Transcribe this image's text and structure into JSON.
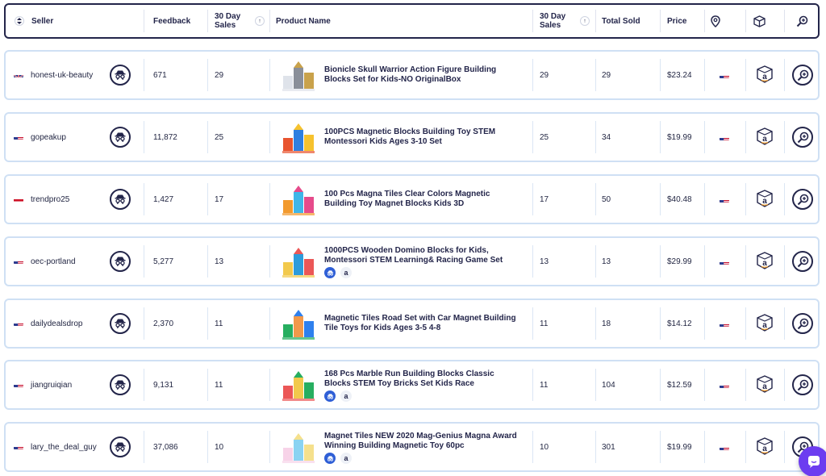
{
  "columns": {
    "seller": "Seller",
    "feedback": "Feedback",
    "sales30": "30 Day Sales",
    "product_name": "Product Name",
    "sales30_b": "30 Day Sales",
    "total_sold": "Total Sold",
    "price": "Price",
    "location_icon": "map-pin-icon",
    "box_icon": "package-icon",
    "zoom_icon": "magnifier-plus-icon"
  },
  "colors": {
    "navy": "#23254a",
    "row_border": "#cfe0f4",
    "prime_blue": "#2f5fd6",
    "chat": "#6c3cf0"
  },
  "rows": [
    {
      "flag": "uk",
      "seller": "honest-uk-beauty",
      "feedback": "671",
      "sales30": "29",
      "product": "Bionicle Skull Warrior Action Figure Building Blocks Set for Kids-NO OriginalBox",
      "sales30_b": "29",
      "total_sold": "29",
      "price": "$23.24",
      "tags": false
    },
    {
      "flag": "us",
      "seller": "gopeakup",
      "feedback": "11,872",
      "sales30": "25",
      "product": "100PCS Magnetic Blocks Building Toy STEM Montessori Kids Ages 3-10 Set",
      "sales30_b": "25",
      "total_sold": "34",
      "price": "$19.99",
      "tags": false
    },
    {
      "flag": "eg",
      "seller": "trendpro25",
      "feedback": "1,427",
      "sales30": "17",
      "product": "100 Pcs Magna Tiles Clear Colors Magnetic Building Toy Magnet Blocks Kids 3D",
      "sales30_b": "17",
      "total_sold": "50",
      "price": "$40.48",
      "tags": false
    },
    {
      "flag": "us",
      "seller": "oec-portland",
      "feedback": "5,277",
      "sales30": "13",
      "product": "1000PCS Wooden Domino Blocks for Kids, Montessori STEM Learning& Racing Game Set",
      "sales30_b": "13",
      "total_sold": "13",
      "price": "$29.99",
      "tags": true
    },
    {
      "flag": "us",
      "seller": "dailydealsdrop",
      "feedback": "2,370",
      "sales30": "11",
      "product": "Magnetic Tiles Road Set with Car Magnet Building Tile Toys for Kids Ages 3-5 4-8",
      "sales30_b": "11",
      "total_sold": "18",
      "price": "$14.12",
      "tags": false
    },
    {
      "flag": "us",
      "seller": "jiangruiqian",
      "feedback": "9,131",
      "sales30": "11",
      "product": "168 Pcs Marble Run Building Blocks Classic Blocks STEM Toy Bricks Set Kids Race",
      "sales30_b": "11",
      "total_sold": "104",
      "price": "$12.59",
      "tags": true
    },
    {
      "flag": "us",
      "seller": "lary_the_deal_guy",
      "feedback": "37,086",
      "sales30": "10",
      "product": "Magnet Tiles NEW 2020 Mag-Genius Magna Award Winning Building Magnetic Toy 60pc",
      "sales30_b": "10",
      "total_sold": "301",
      "price": "$19.99",
      "tags": true
    }
  ],
  "tag_amazon_letter": "a",
  "chat": {
    "icon": "chat-bubble-icon"
  }
}
